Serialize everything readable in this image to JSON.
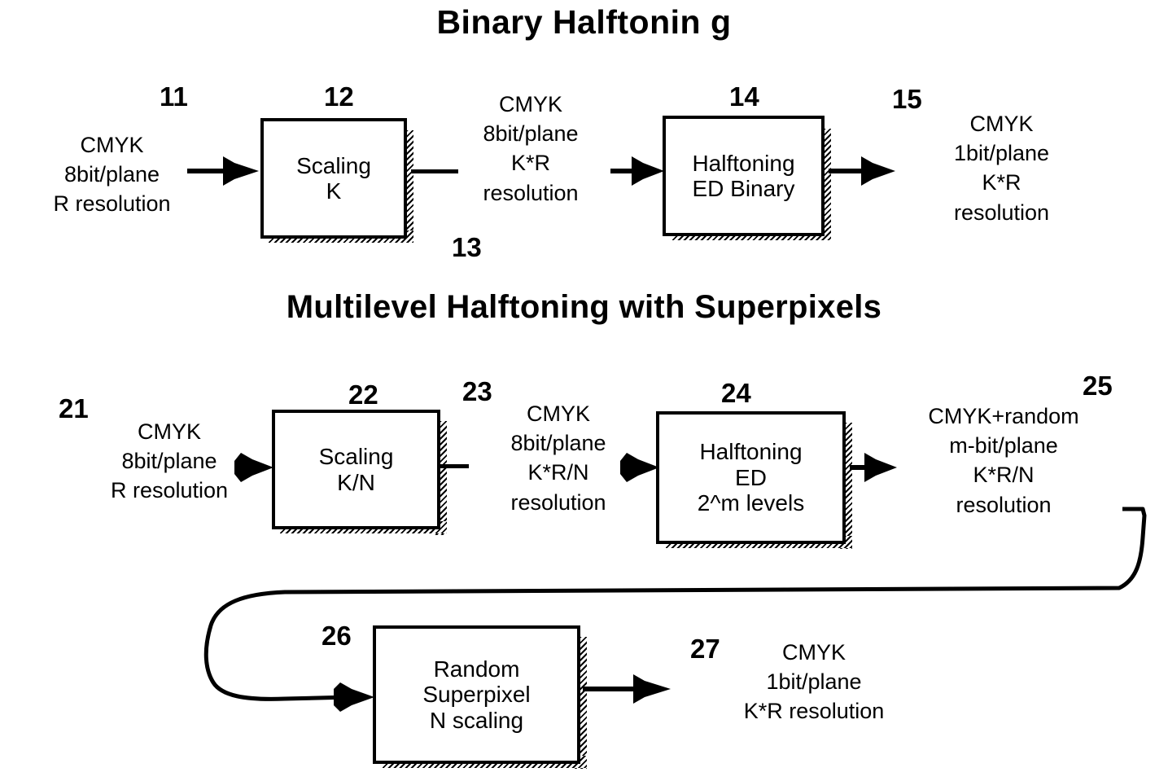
{
  "diagram": {
    "sections": [
      {
        "id": "binary",
        "title": "Binary Halftonin g"
      },
      {
        "id": "multilevel",
        "title": "Multilevel Halftoning with Superpixels"
      }
    ],
    "row1": {
      "input": {
        "ref": "11",
        "lines": [
          "CMYK",
          "8bit/plane",
          "R resolution"
        ]
      },
      "box_scaling": {
        "ref": "12",
        "lines": [
          "Scaling",
          "K"
        ]
      },
      "intermediate": {
        "ref": "13",
        "lines": [
          "CMYK",
          "8bit/plane",
          "K*R",
          "resolution"
        ]
      },
      "box_halftoning": {
        "ref": "14",
        "lines": [
          "Halftoning",
          "ED Binary"
        ]
      },
      "output": {
        "ref": "15",
        "inline_first_line": "CMYK",
        "lines": [
          "1bit/plane",
          "K*R",
          "resolution"
        ]
      }
    },
    "row2": {
      "input": {
        "ref": "21",
        "inline_first_line": "CMYK",
        "lines": [
          "8bit/plane",
          "R resolution"
        ]
      },
      "box_scaling": {
        "ref": "22",
        "lines": [
          "Scaling",
          "K/N"
        ]
      },
      "intermediate": {
        "ref": "23",
        "inline_first_line": "CMYK",
        "lines": [
          "8bit/plane",
          "K*R/N",
          "resolution"
        ]
      },
      "box_halftoning": {
        "ref": "24",
        "lines": [
          "Halftoning",
          "ED",
          "2^m levels"
        ]
      },
      "output": {
        "ref": "25",
        "lines": [
          "CMYK+random",
          "m-bit/plane",
          "K*R/N",
          "resolution"
        ]
      }
    },
    "row3": {
      "box_superpixel": {
        "ref": "26",
        "lines": [
          "Random",
          "Superpixel",
          "N scaling"
        ]
      },
      "output": {
        "ref": "27",
        "inline_first_line": "CMYK",
        "lines": [
          "1bit/plane",
          "K*R resolution"
        ]
      }
    },
    "colors": {
      "ink": "#000000",
      "paper": "#ffffff"
    }
  }
}
